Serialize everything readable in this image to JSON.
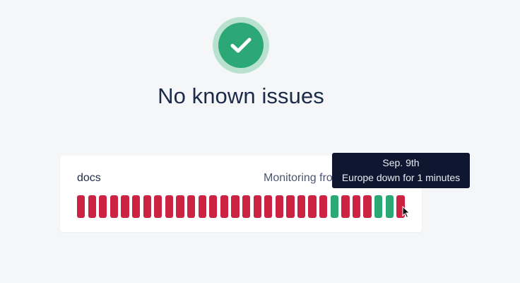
{
  "status": {
    "icon": "checkmark-icon",
    "headline": "No known issues",
    "colors": {
      "ok": "#2ba876",
      "ok_ring": "#b8e2cf"
    }
  },
  "monitor": {
    "service_name": "docs",
    "monitoring_text": "Monitoring from",
    "uptime_days": [
      "down",
      "down",
      "down",
      "down",
      "down",
      "down",
      "down",
      "down",
      "down",
      "down",
      "down",
      "down",
      "down",
      "down",
      "down",
      "down",
      "down",
      "down",
      "down",
      "down",
      "down",
      "down",
      "down",
      "up",
      "down",
      "down",
      "down",
      "up",
      "up",
      "down"
    ],
    "colors": {
      "up": "#2ba876",
      "down": "#cc2244"
    }
  },
  "tooltip": {
    "date": "Sep. 9th",
    "message": "Europe down for 1 minutes"
  }
}
